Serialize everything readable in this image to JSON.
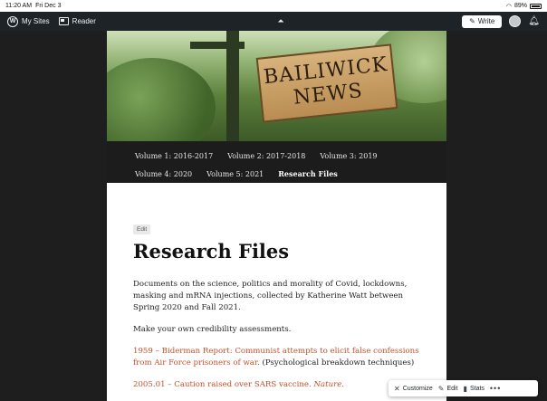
{
  "status_bar": {
    "time": "11:20 AM",
    "date": "Fri Dec 3",
    "battery": "89%"
  },
  "admin_bar": {
    "my_sites": "My Sites",
    "reader": "Reader",
    "write": "Write"
  },
  "header": {
    "sign_line1": "BAILIWICK",
    "sign_line2": "NEWS"
  },
  "nav": {
    "row1": [
      "Volume 1: 2016-2017",
      "Volume 2: 2017-2018",
      "Volume 3: 2019"
    ],
    "row2": [
      "Volume 4: 2020",
      "Volume 5: 2021",
      "Research Files"
    ],
    "current": "Research Files"
  },
  "content": {
    "edit_label": "Edit",
    "title": "Research Files",
    "intro": "Documents on the science, politics and morality of Covid, lockdowns, masking and mRNA injections, collected by Katherine Watt between Spring 2020 and Fall 2021.",
    "credibility": "Make your own credibility assessments.",
    "item1_link": "1959 – Biderman Report: Communist attempts to elicit false confessions from Air Force prisoners of war.",
    "item1_note": " (Psychological breakdown techniques)",
    "item2_link": "2005.01 – Caution raised over SARS vaccine. ",
    "item2_source": "Nature."
  },
  "float_bar": {
    "customize": "Customize",
    "edit": "Edit",
    "stats": "Stats",
    "more": "•••"
  },
  "colors": {
    "admin_bar": "#1d2327",
    "link": "#c4512c",
    "nav_bg": "#1c1c1c",
    "background": "#1e1e1e"
  }
}
